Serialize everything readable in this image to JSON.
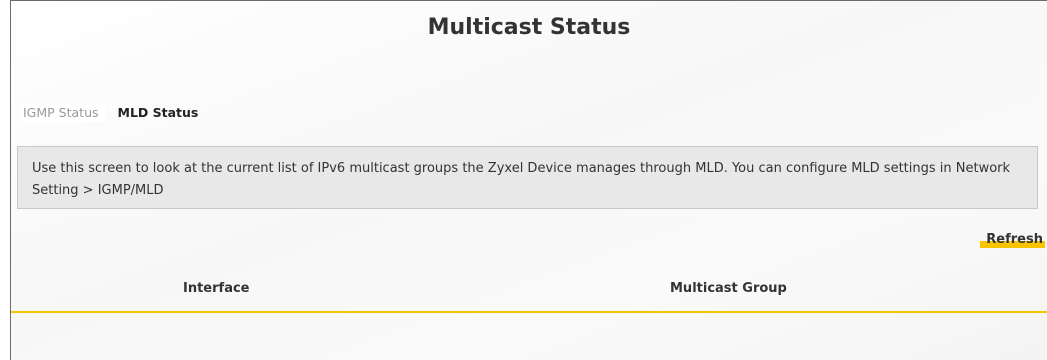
{
  "page": {
    "title": "Multicast Status"
  },
  "tabs": [
    {
      "label": "IGMP Status",
      "active": false
    },
    {
      "label": "MLD Status",
      "active": true
    }
  ],
  "description": "Use this screen to look at the current list of IPv6 multicast groups the Zyxel Device manages through MLD. You can configure MLD settings in Network Setting > IGMP/MLD",
  "toolbar": {
    "refresh_label": "Refresh"
  },
  "table": {
    "columns": [
      "Interface",
      "Multicast Group"
    ],
    "rows": []
  },
  "colors": {
    "accent": "#f7c500",
    "description_bg": "#e8e8e8"
  }
}
